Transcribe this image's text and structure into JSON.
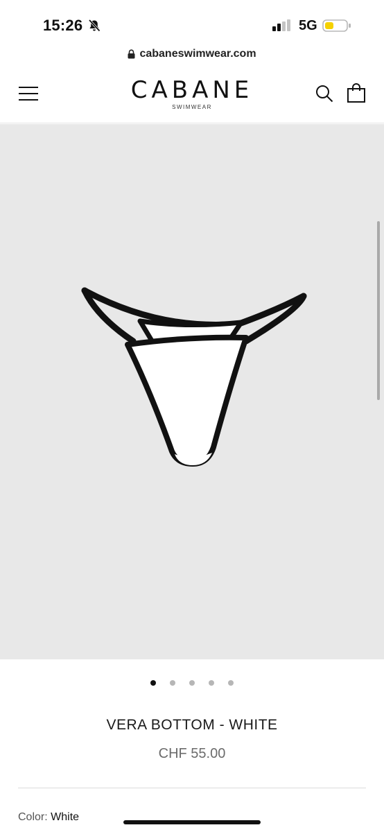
{
  "status_bar": {
    "time": "15:26",
    "network": "5G",
    "mute_icon": "bell-slash-icon",
    "signal_icon": "signal-bars-icon",
    "battery_icon": "battery-low-icon",
    "battery_color": "#f5d100"
  },
  "browser": {
    "url": "cabaneswimwear.com",
    "lock_icon": "lock-icon"
  },
  "header": {
    "logo_main": "CABANE",
    "logo_sub": "SWIMWEAR",
    "menu_icon": "hamburger-menu-icon",
    "search_icon": "search-icon",
    "cart_icon": "shopping-bag-icon"
  },
  "gallery": {
    "background": "#e8e8e8",
    "image_count": 5,
    "active_index": 0
  },
  "product": {
    "title": "VERA BOTTOM - WHITE",
    "price": "CHF 55.00",
    "color_label": "Color:",
    "color_value": "White"
  }
}
